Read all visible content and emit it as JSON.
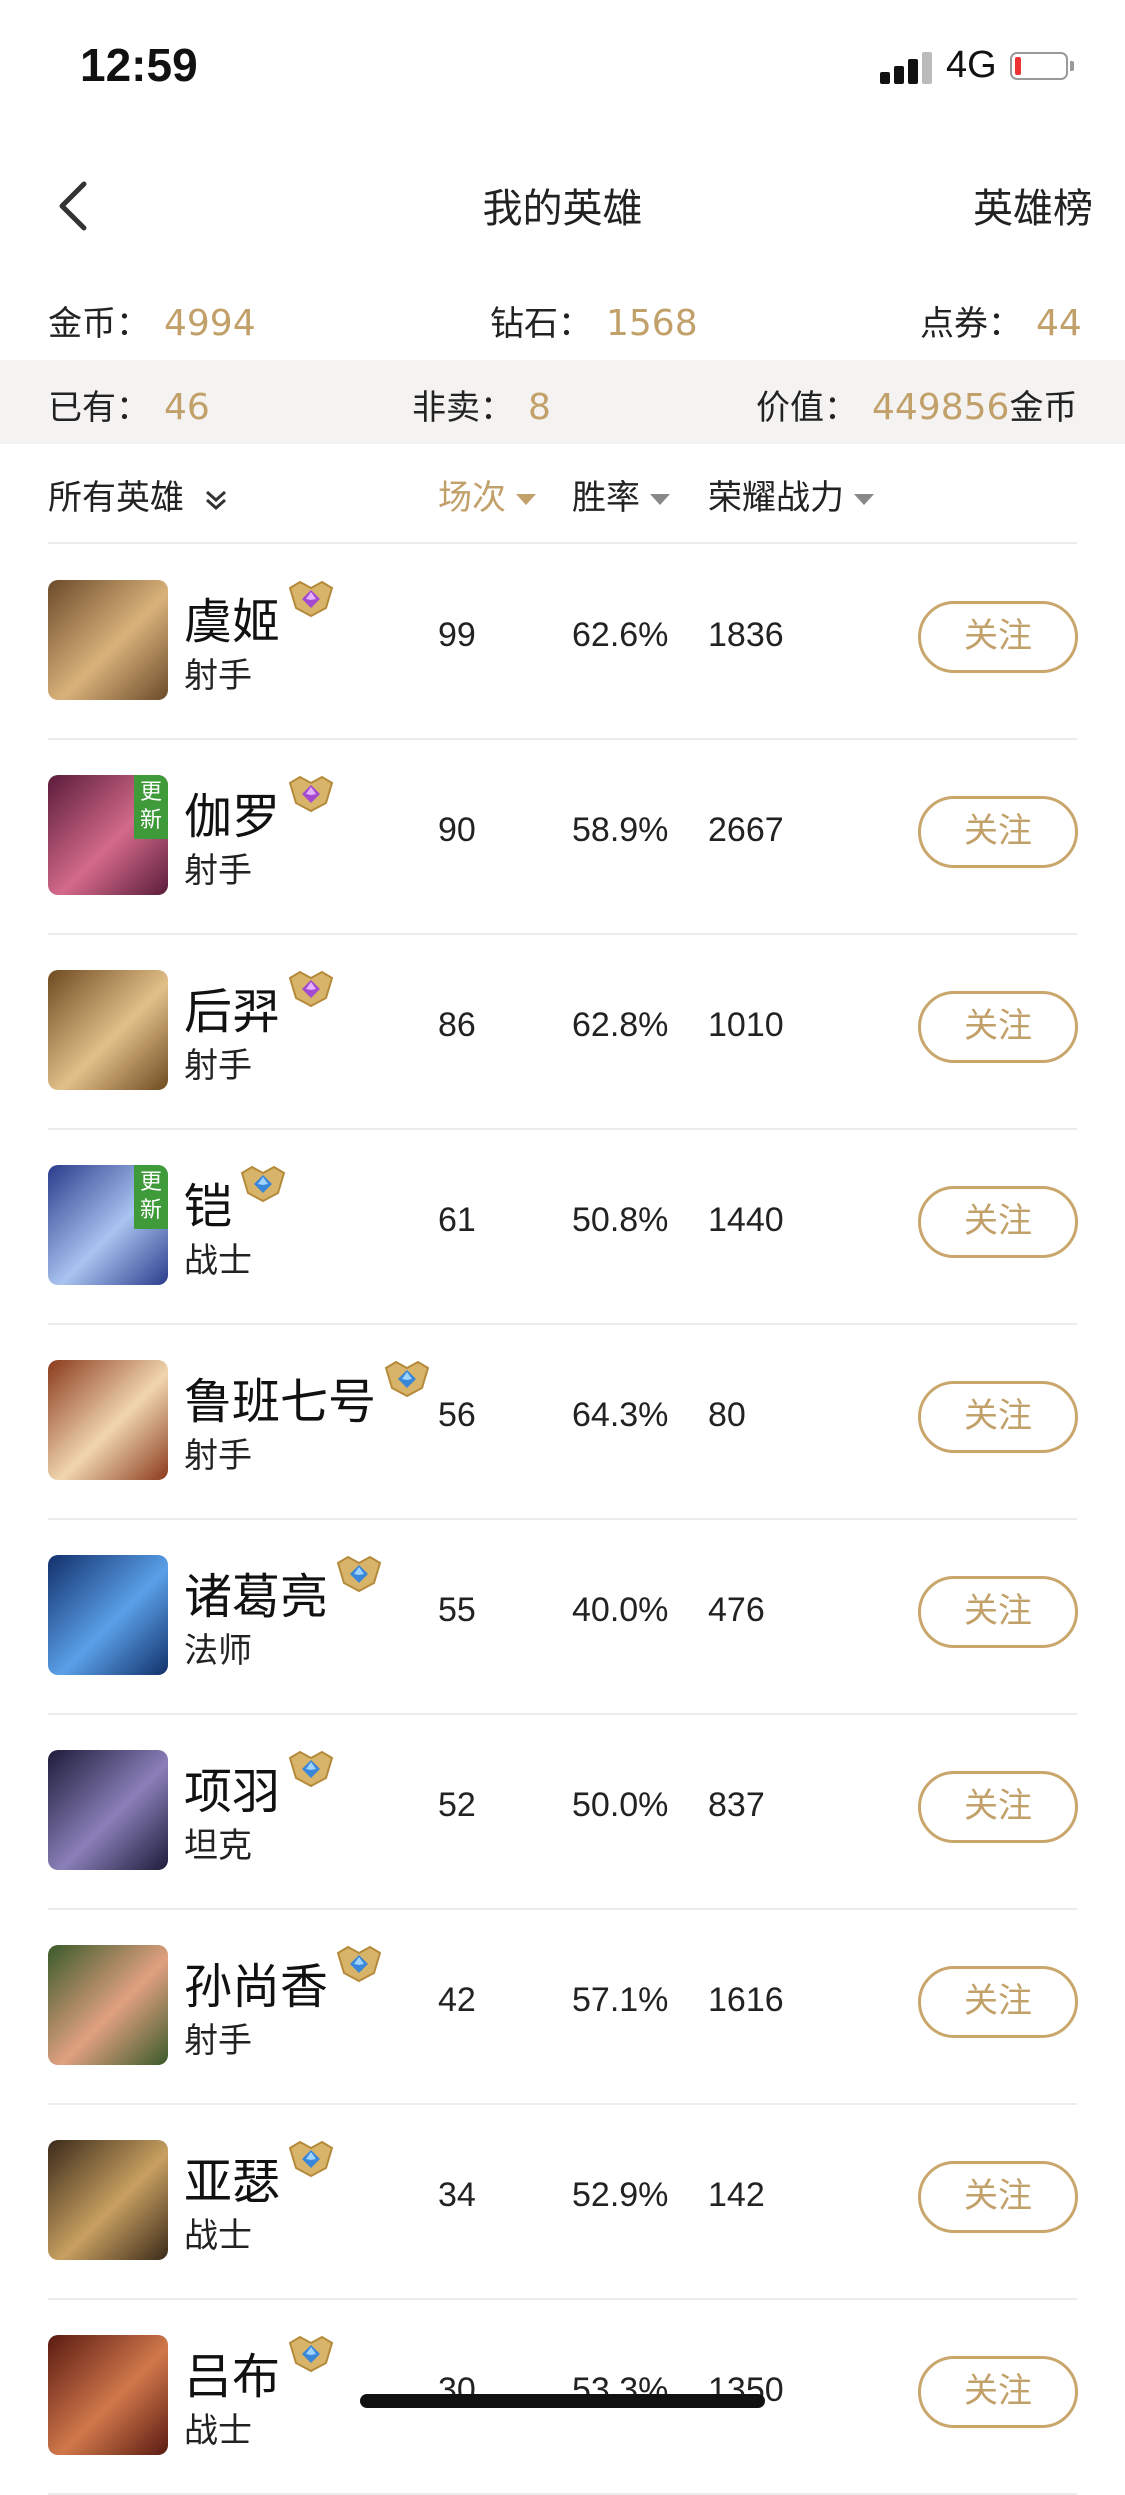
{
  "status_bar": {
    "time": "12:59",
    "network": "4G"
  },
  "nav": {
    "title": "我的英雄",
    "right_link": "英雄榜"
  },
  "stats": {
    "coins_label": "金币：",
    "coins_value": "4994",
    "diamonds_label": "钻石：",
    "diamonds_value": "1568",
    "vouchers_label": "点券：",
    "vouchers_value": "44",
    "owned_label": "已有：",
    "owned_value": "46",
    "not_for_sale_label": "非卖：",
    "not_for_sale_value": "8",
    "worth_label": "价值：",
    "worth_value": "449856",
    "worth_unit": "金币"
  },
  "header": {
    "filter": "所有英雄",
    "matches": "场次",
    "winrate": "胜率",
    "power": "荣耀战力"
  },
  "follow_label": "关注",
  "heroes": [
    {
      "name": "虞姬",
      "role": "射手",
      "matches": "99",
      "winrate": "62.6%",
      "power": "1836",
      "rank": "purple",
      "new": "",
      "colors": [
        "#6b4a2a",
        "#d9b27a"
      ]
    },
    {
      "name": "伽罗",
      "role": "射手",
      "matches": "90",
      "winrate": "58.9%",
      "power": "2667",
      "rank": "purple",
      "new": "更新",
      "colors": [
        "#5a1c3a",
        "#d46a8a"
      ]
    },
    {
      "name": "后羿",
      "role": "射手",
      "matches": "86",
      "winrate": "62.8%",
      "power": "1010",
      "rank": "purple",
      "new": "",
      "colors": [
        "#6e4a20",
        "#e2c089"
      ]
    },
    {
      "name": "铠",
      "role": "战士",
      "matches": "61",
      "winrate": "50.8%",
      "power": "1440",
      "rank": "blue",
      "new": "更新",
      "colors": [
        "#2a3c8c",
        "#a9c4f0"
      ]
    },
    {
      "name": "鲁班七号",
      "role": "射手",
      "matches": "56",
      "winrate": "64.3%",
      "power": "80",
      "rank": "blue",
      "new": "",
      "colors": [
        "#8a3a1c",
        "#f0d6b0"
      ]
    },
    {
      "name": "诸葛亮",
      "role": "法师",
      "matches": "55",
      "winrate": "40.0%",
      "power": "476",
      "rank": "blue",
      "new": "",
      "colors": [
        "#12306a",
        "#5aa0e8"
      ]
    },
    {
      "name": "项羽",
      "role": "坦克",
      "matches": "52",
      "winrate": "50.0%",
      "power": "837",
      "rank": "blue",
      "new": "",
      "colors": [
        "#1c1c3a",
        "#8a7fb8"
      ]
    },
    {
      "name": "孙尚香",
      "role": "射手",
      "matches": "42",
      "winrate": "57.1%",
      "power": "1616",
      "rank": "blue",
      "new": "",
      "colors": [
        "#3a5a2a",
        "#e0a080"
      ]
    },
    {
      "name": "亚瑟",
      "role": "战士",
      "matches": "34",
      "winrate": "52.9%",
      "power": "142",
      "rank": "blue",
      "new": "",
      "colors": [
        "#3a2a1a",
        "#c8a060"
      ]
    },
    {
      "name": "吕布",
      "role": "战士",
      "matches": "30",
      "winrate": "53.3%",
      "power": "1350",
      "rank": "blue",
      "new": "",
      "colors": [
        "#5a1a12",
        "#d0784a"
      ]
    }
  ]
}
